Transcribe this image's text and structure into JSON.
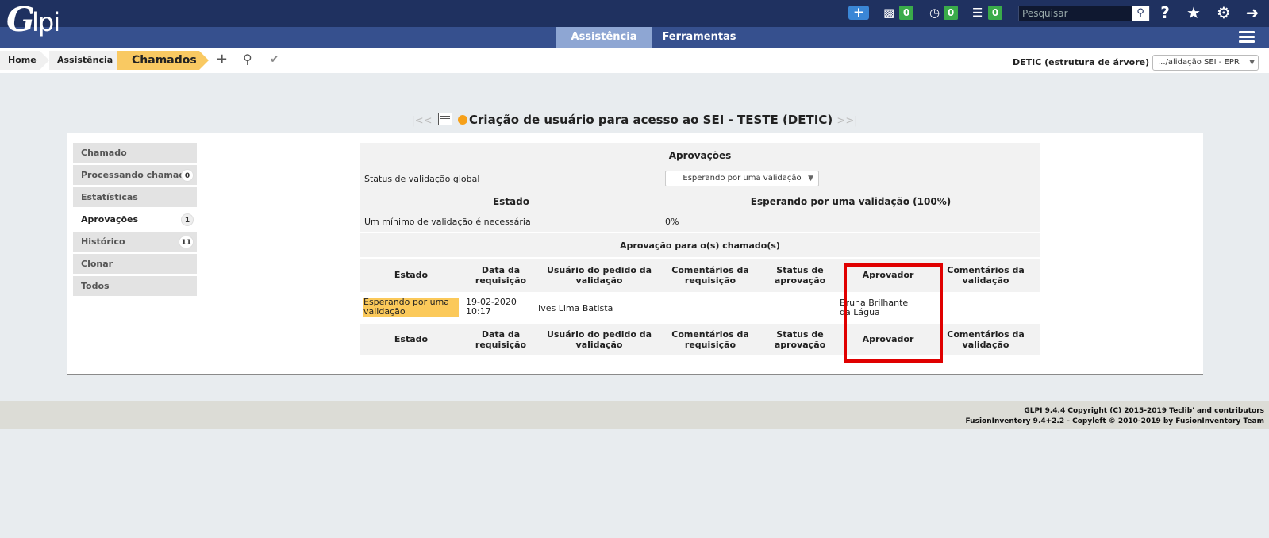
{
  "app": {
    "logo_text_g": "G",
    "logo_text_lpi": "lpi",
    "brand_colors": {
      "topbar": "#1f3160",
      "menubar": "#36508e",
      "active_tab": "#8ea6d3",
      "current_crumb": "#f9c962",
      "counter_badge": "#3aab4a",
      "highlight_box": "#e00000"
    }
  },
  "topbar": {
    "add_icon": "plus-icon",
    "counters": [
      {
        "icon": "ticket-icon",
        "value": "0"
      },
      {
        "icon": "clock-icon",
        "value": "0"
      },
      {
        "icon": "checklist-icon",
        "value": "0"
      }
    ],
    "search_placeholder": "Pesquisar",
    "icons": [
      "help-icon",
      "star-icon",
      "gear-icon",
      "logout-icon"
    ]
  },
  "menu": {
    "tabs": [
      {
        "label": "Assistência",
        "active": true
      },
      {
        "label": "Ferramentas",
        "active": false
      }
    ]
  },
  "breadcrumb": {
    "items": [
      "Home",
      "Assistência",
      "Chamados"
    ],
    "actions": [
      "add-icon",
      "search-icon",
      "validation-icon"
    ],
    "entity_label": "DETIC (estrutura de árvore)",
    "entity_value": ".../alidação SEI - EPR"
  },
  "ticket": {
    "title": "Criação de usuário para acesso ao SEI - TESTE (DETIC)",
    "prev": "|<<",
    "next": ">>|"
  },
  "sidebar": {
    "items": [
      {
        "label": "Chamado",
        "badge": ""
      },
      {
        "label": "Processando chamado",
        "badge": "0"
      },
      {
        "label": "Estatísticas",
        "badge": ""
      },
      {
        "label": "Aprovações",
        "badge": "1"
      },
      {
        "label": "Histórico",
        "badge": "11"
      },
      {
        "label": "Clonar",
        "badge": ""
      },
      {
        "label": "Todos",
        "badge": ""
      }
    ]
  },
  "approvals": {
    "section_title": "Aprovações",
    "global_status_label": "Status de validação global",
    "global_status_value": "Esperando por uma validação",
    "state_label": "Estado",
    "state_value": "Esperando por uma validação (100%)",
    "min_label": "Um mínimo de validação é necessária",
    "min_value": "0%",
    "list_title": "Aprovação para o(s) chamado(s)",
    "columns": [
      "Estado",
      "Data da requisição",
      "Usuário do pedido da validação",
      "Comentários da requisição",
      "Status de aprovação",
      "Aprovador",
      "Comentários da validação"
    ],
    "rows": [
      {
        "estado": "Esperando por uma validação",
        "data": "19-02-2020 10:17",
        "usuario": "Ives Lima Batista",
        "comentarios_req": "",
        "status": "",
        "aprovador": "Bruna Brilhante da Lágua",
        "comentarios_val": ""
      }
    ]
  },
  "footer": {
    "line1": "GLPI 9.4.4 Copyright (C) 2015-2019 Teclib' and contributors",
    "line2": "FusionInventory 9.4+2.2 - Copyleft © 2010-2019 by FusionInventory Team"
  }
}
